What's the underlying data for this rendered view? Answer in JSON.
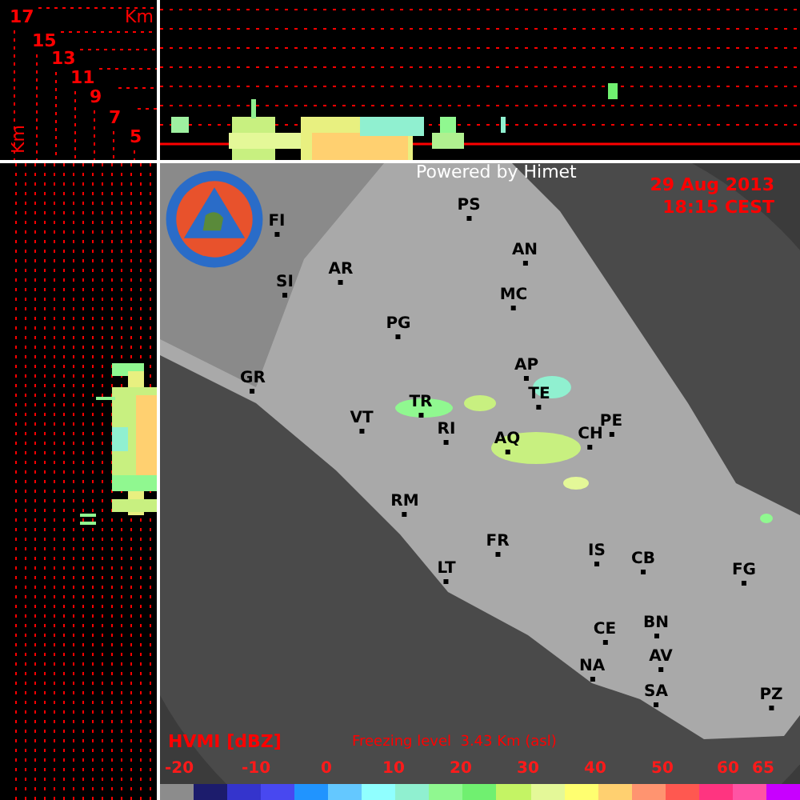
{
  "vertical_section": {
    "altitudes": [
      "17",
      "15",
      "13",
      "11",
      "9",
      "7",
      "5"
    ],
    "unit": "Km",
    "axis_unit": "Km"
  },
  "map": {
    "credit": "Powered by Himet",
    "date": "29 Aug 2013",
    "time": "18:15 CEST",
    "cities": [
      "FI",
      "PS",
      "AN",
      "SI",
      "AR",
      "MC",
      "PG",
      "AP",
      "TE",
      "GR",
      "TR",
      "VT",
      "RI",
      "PE",
      "AQ",
      "CH",
      "RM",
      "FR",
      "IS",
      "CB",
      "LT",
      "FG",
      "BN",
      "CE",
      "AV",
      "NA",
      "SA",
      "PZ"
    ]
  },
  "legend": {
    "product": "HVMI [dBZ]",
    "freezing_level": "Freezing level  3.43 Km (asl)",
    "ticks": [
      "-20",
      "-10",
      "0",
      "10",
      "20",
      "30",
      "40",
      "50",
      "60",
      "65"
    ],
    "scale": [
      {
        "color": "#8c8c8c"
      },
      {
        "color": "#1c1c6c"
      },
      {
        "color": "#3434cc"
      },
      {
        "color": "#4848f0"
      },
      {
        "color": "#2094ff"
      },
      {
        "color": "#64c8ff"
      },
      {
        "color": "#90ffff"
      },
      {
        "color": "#90f0d0"
      },
      {
        "color": "#90f890"
      },
      {
        "color": "#70f070"
      },
      {
        "color": "#c4f464"
      },
      {
        "color": "#e4f898"
      },
      {
        "color": "#ffff70"
      },
      {
        "color": "#ffd070"
      },
      {
        "color": "#ff9470"
      },
      {
        "color": "#ff5850"
      },
      {
        "color": "#ff3480"
      },
      {
        "color": "#ff54a4"
      },
      {
        "color": "#c800ff"
      }
    ]
  }
}
